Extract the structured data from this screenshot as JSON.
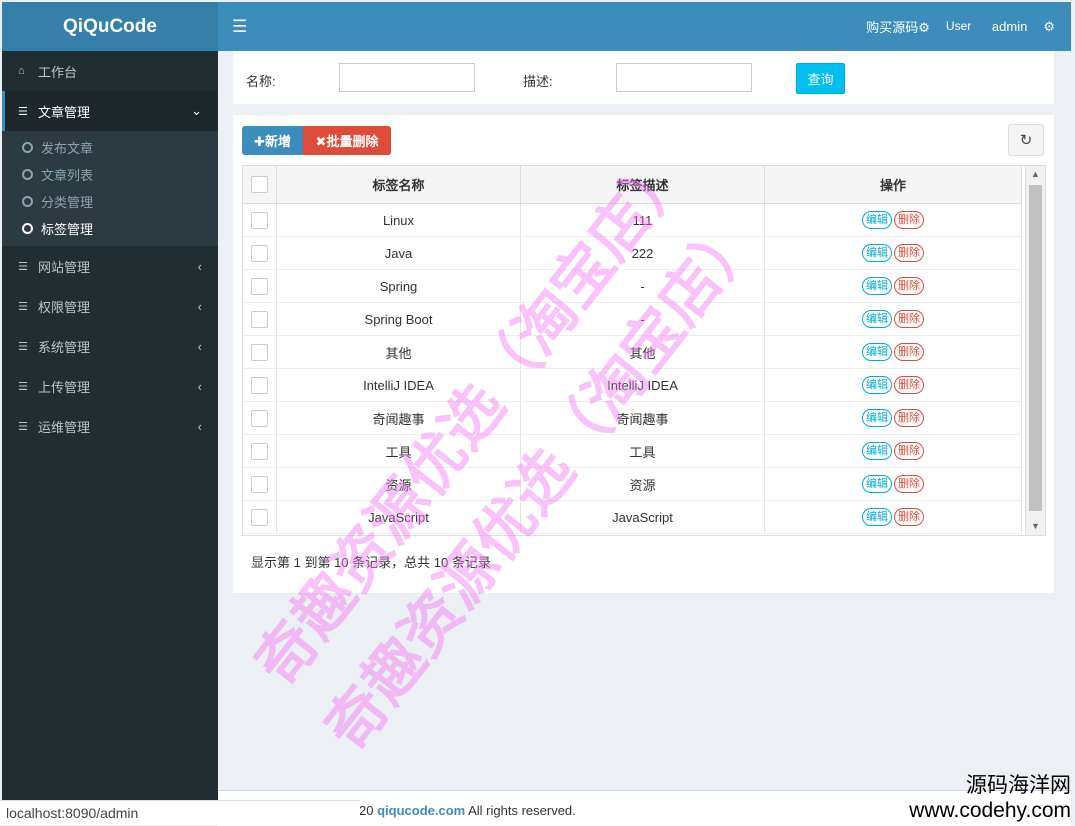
{
  "app": {
    "logo": "QiQuCode"
  },
  "topbar": {
    "menu_icon": "bars-icon",
    "buy_link": "购买源码",
    "user_img_alt": "User",
    "username": "admin"
  },
  "sidebar": {
    "items": [
      {
        "label": "工作台",
        "icon": "home-icon"
      },
      {
        "label": "文章管理",
        "icon": "list-icon",
        "open": true
      },
      {
        "label": "网站管理",
        "icon": "list-icon"
      },
      {
        "label": "权限管理",
        "icon": "list-icon"
      },
      {
        "label": "系统管理",
        "icon": "list-icon"
      },
      {
        "label": "上传管理",
        "icon": "list-icon"
      },
      {
        "label": "运维管理",
        "icon": "list-icon"
      }
    ],
    "sub_items": [
      "发布文章",
      "文章列表",
      "分类管理",
      "标签管理"
    ],
    "active_sub": "标签管理"
  },
  "search": {
    "name_label": "名称:",
    "desc_label": "描述:",
    "name_value": "",
    "desc_value": "",
    "query_button": "查询"
  },
  "toolbar": {
    "add_button": "✚新增",
    "batch_delete_button": "✖批量删除"
  },
  "table": {
    "headers": [
      "标签名称",
      "标签描述",
      "操作"
    ],
    "edit_label": "编辑",
    "delete_label": "删除",
    "rows": [
      {
        "name": "Linux",
        "desc": "111"
      },
      {
        "name": "Java",
        "desc": "222"
      },
      {
        "name": "Spring",
        "desc": "-"
      },
      {
        "name": "Spring Boot",
        "desc": "-"
      },
      {
        "name": "其他",
        "desc": "其他"
      },
      {
        "name": "IntelliJ IDEA",
        "desc": "IntelliJ IDEA"
      },
      {
        "name": "奇闻趣事",
        "desc": "奇闻趣事"
      },
      {
        "name": "工具",
        "desc": "工具"
      },
      {
        "name": "资源",
        "desc": "资源"
      },
      {
        "name": "JavaScript",
        "desc": "JavaScript"
      }
    ]
  },
  "pager": {
    "info": "显示第 1 到第 10 条记录，总共 10 条记录"
  },
  "footer": {
    "year_fragment": "20",
    "site": "qiqucode.com",
    "rights": "All rights reserved."
  },
  "statusbar": {
    "url": "localhost:8090/admin"
  },
  "watermarks": {
    "diagonal_1": "奇趣资源优选（淘宝店）",
    "diagonal_2": "奇趣资源优选（淘宝店）",
    "corner_cn": "源码海洋网",
    "corner_url": "www.codehy.com"
  },
  "colors": {
    "header": "#3c8dbc",
    "sidebar": "#222d32",
    "add": "#3c8dbc",
    "delete": "#dd4b39",
    "query": "#00c0ef"
  }
}
